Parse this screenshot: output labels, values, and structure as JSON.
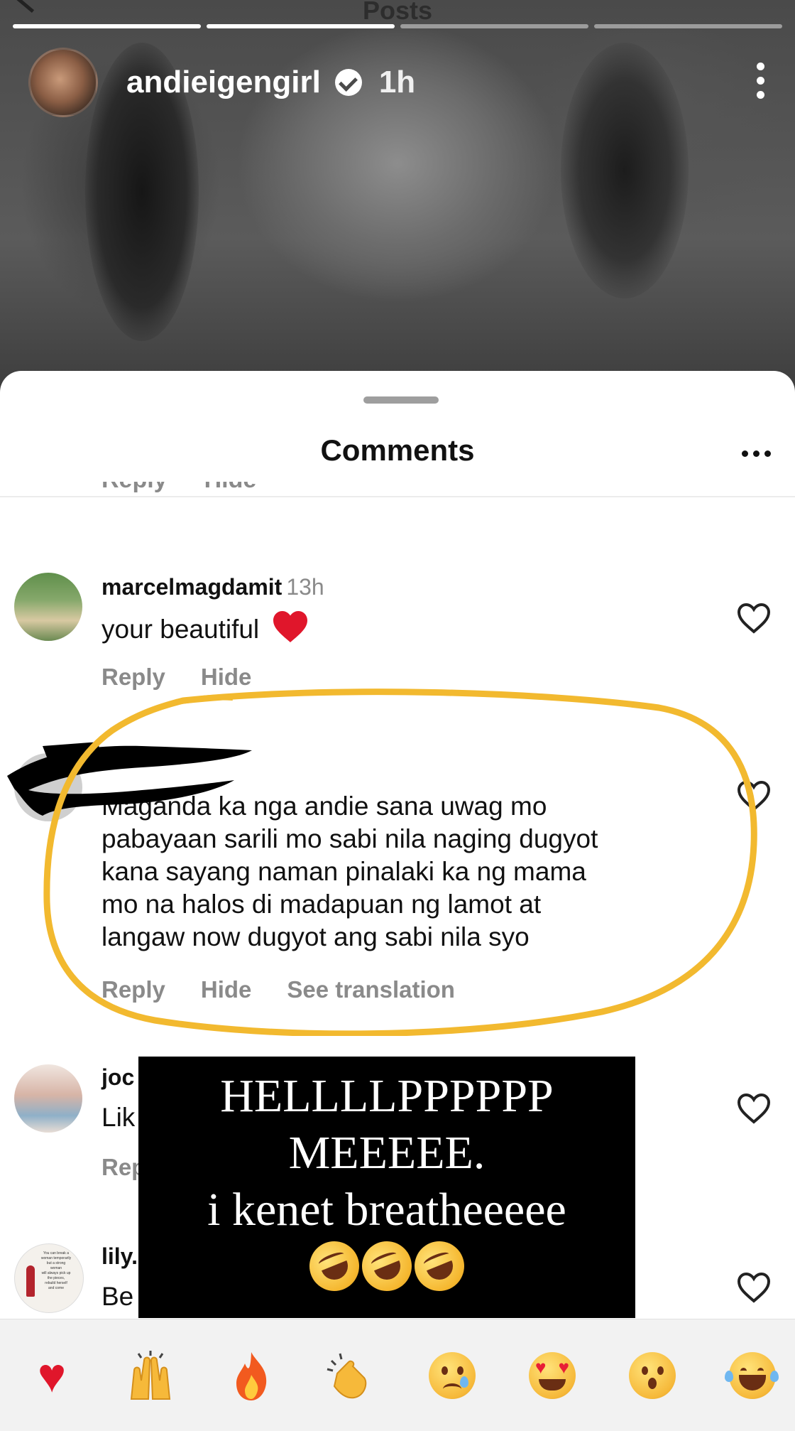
{
  "story": {
    "header_label": "Posts",
    "username": "andieigengirl",
    "time": "1h"
  },
  "sheet": {
    "title": "Comments"
  },
  "top_actions": {
    "reply": "Reply",
    "hide": "Hide"
  },
  "comments": [
    {
      "username": "marcelmagdamit",
      "time": "13h",
      "text": "your beautiful",
      "reply": "Reply",
      "hide": "Hide"
    },
    {
      "text_lines": [
        "Maganda ka nga andie sana uwag mo",
        "pabayaan sarili mo sabi nila naging dugyot",
        "kana sayang naman pinalaki ka ng mama",
        "mo na halos di madapuan ng lamot at",
        "langaw now dugyot ang sabi nila syo"
      ],
      "reply": "Reply",
      "hide": "Hide",
      "translate": "See translation"
    },
    {
      "username_partial": "joc",
      "text_partial": "Lik",
      "reply_partial": "Rep"
    },
    {
      "username_partial": "lily.",
      "text_partial": "Be"
    }
  ],
  "avatar_texts": {
    "lily_quote": [
      "You can break a",
      "woman temporarily",
      "but a strong",
      "woman",
      "will always pick up",
      "the pieces,",
      "rebuild herself",
      "and come"
    ]
  },
  "meme_overlay": {
    "line1": "HELLLLPPPPPP",
    "line2": "MEEEEE.",
    "line3": "i kenet breatheeeee",
    "emoji": "rolling-on-floor-laughing x3"
  },
  "reactions": [
    "red-heart",
    "raising-hands",
    "fire",
    "clapping-hands",
    "crying-face",
    "heart-eyes-face",
    "surprised-face",
    "tears-of-joy-face"
  ],
  "colors": {
    "annotation_circle": "#f2b92f",
    "heart_red": "#e0162b",
    "secondary_text": "#8a8a8a"
  }
}
